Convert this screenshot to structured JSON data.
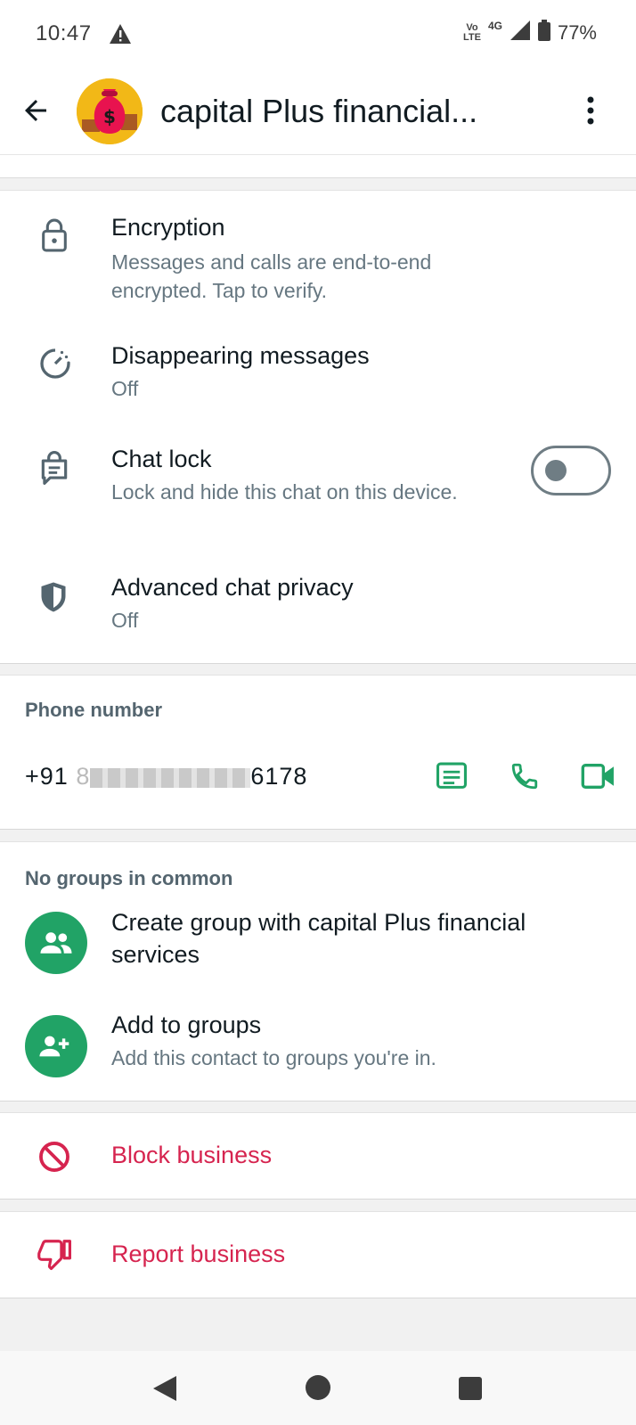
{
  "status_bar": {
    "time": "10:47",
    "network_line1": "Vo",
    "network_line2": "LTE",
    "network_type": "4G",
    "battery": "77%"
  },
  "header": {
    "title": "capital Plus financial..."
  },
  "security": {
    "encryption": {
      "title": "Encryption",
      "subtitle": "Messages and calls are end-to-end encrypted. Tap to verify."
    },
    "disappearing": {
      "title": "Disappearing messages",
      "subtitle": "Off"
    },
    "chat_lock": {
      "title": "Chat lock",
      "subtitle": "Lock and hide this chat on this device.",
      "enabled": false
    },
    "advanced_privacy": {
      "title": "Advanced chat privacy",
      "subtitle": "Off"
    }
  },
  "phone": {
    "label": "Phone number",
    "prefix": "+91",
    "mask_start": "8",
    "visible_suffix": "6178"
  },
  "groups": {
    "label": "No groups in common",
    "create": "Create group with capital Plus financial services",
    "add_title": "Add to groups",
    "add_subtitle": "Add this contact to groups you're in."
  },
  "actions": {
    "block": "Block business",
    "report": "Report business"
  },
  "colors": {
    "accent_green": "#21a366",
    "danger_red": "#d6244f",
    "icon_gray": "#54656f",
    "avatar_bg": "#f2b817"
  }
}
